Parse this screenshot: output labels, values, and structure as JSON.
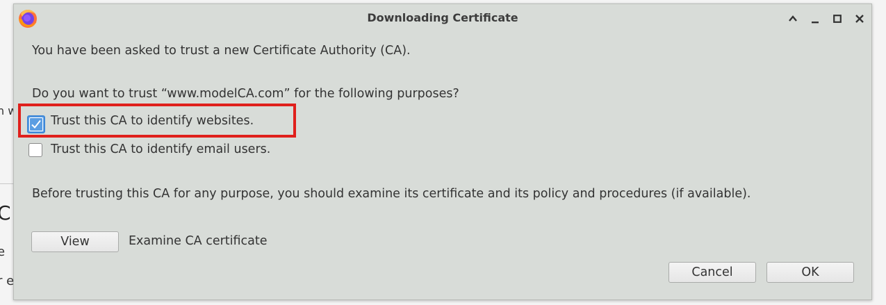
{
  "background": {
    "fragments": [
      "n w",
      "C",
      "e",
      "r e"
    ]
  },
  "window": {
    "title": "Downloading Certificate",
    "app_icon": "firefox-icon",
    "controls": [
      "chevron-up-icon",
      "minimize-icon",
      "maximize-icon",
      "close-icon"
    ]
  },
  "dialog": {
    "intro": "You have been asked to trust a new Certificate Authority (CA).",
    "question": "Do you want to trust “www.modelCA.com” for the following purposes?",
    "options": [
      {
        "label": "Trust this CA to identify websites.",
        "checked": true
      },
      {
        "label": "Trust this CA to identify email users.",
        "checked": false
      }
    ],
    "advice": "Before trusting this CA for any purpose, you should examine its certificate and its policy and procedures (if available).",
    "view_button": "View",
    "examine_label": "Examine CA certificate",
    "cancel_button": "Cancel",
    "ok_button": "OK"
  },
  "colors": {
    "dialog_bg": "#d8dcd8",
    "highlight": "#e0201c",
    "checkbox_accent": "#5b9de2"
  }
}
